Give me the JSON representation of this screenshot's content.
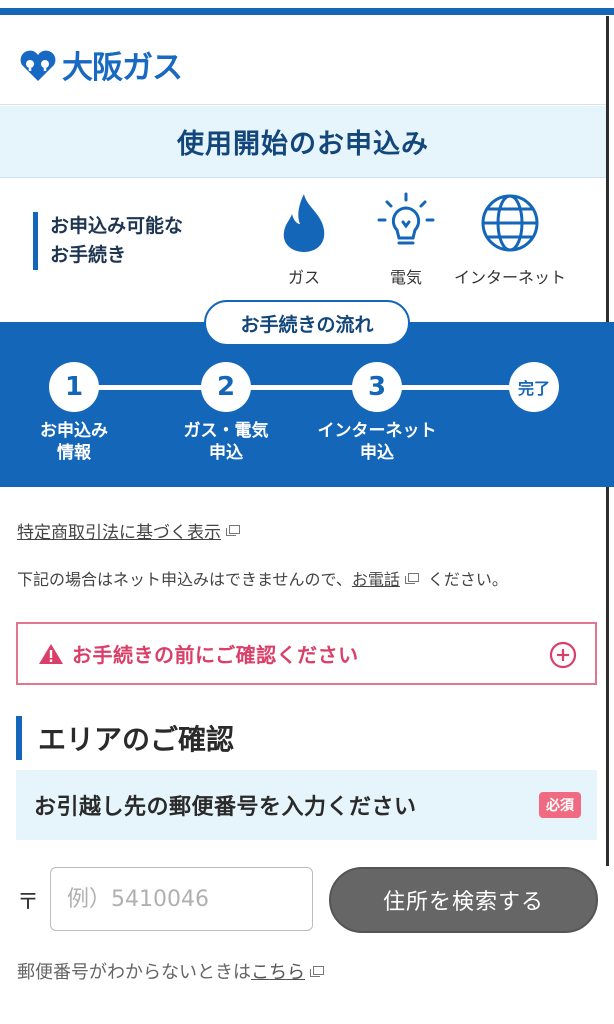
{
  "brand": {
    "name": "大阪ガス",
    "color": "#1769c2"
  },
  "title": "使用開始のお申込み",
  "available": {
    "line1": "お申込み可能な",
    "line2": "お手続き"
  },
  "services": [
    {
      "label": "ガス",
      "icon": "flame-icon"
    },
    {
      "label": "電気",
      "icon": "lightbulb-icon"
    },
    {
      "label": "インターネット",
      "icon": "globe-icon"
    }
  ],
  "flow": {
    "title": "お手続きの流れ",
    "steps": [
      {
        "num": "1",
        "label1": "お申込み",
        "label2": "情報"
      },
      {
        "num": "2",
        "label1": "ガス・電気",
        "label2": "申込"
      },
      {
        "num": "3",
        "label1": "インターネット",
        "label2": "申込"
      },
      {
        "num": "完了",
        "label1": "",
        "label2": ""
      }
    ]
  },
  "law_link": "特定商取引法に基づく表示",
  "note": {
    "before": "下記の場合はネット申込みはできませんので、",
    "link": "お電話",
    "after": "ください。"
  },
  "alert": {
    "text": "お手続きの前にご確認ください"
  },
  "area": {
    "title": "エリアのご確認",
    "zip_prompt": "お引越し先の郵便番号を入力ください",
    "required": "必須",
    "postal_mark": "〒",
    "zip_placeholder": "例）5410046",
    "zip_value": "",
    "search_button": "住所を検索する",
    "unknown_before": "郵便番号がわからないときは",
    "unknown_link": "こちら"
  },
  "colors": {
    "primary": "#1466b8",
    "alert": "#d93f69",
    "required": "#f06b82",
    "band": "#e6f4fb"
  }
}
